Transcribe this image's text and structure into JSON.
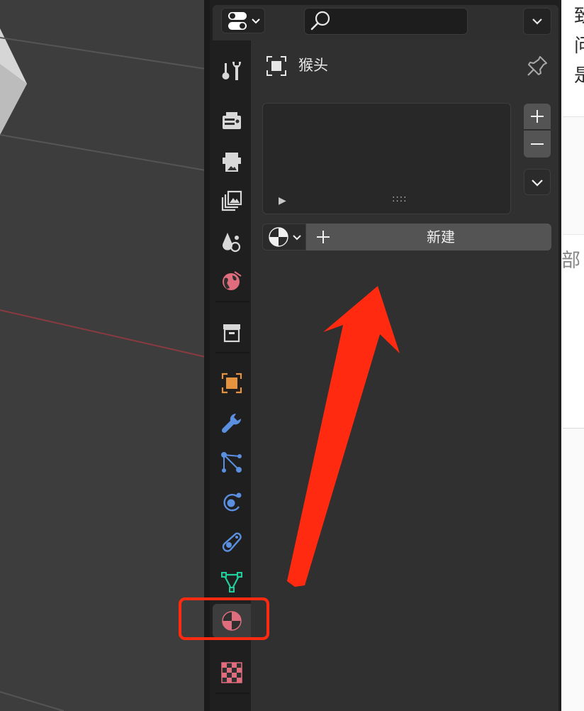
{
  "properties": {
    "object_name": "猴头",
    "search": {
      "placeholder": ""
    },
    "new_material_label": "新建"
  },
  "tabs": [
    "tool",
    "render",
    "output",
    "view-layer",
    "scene",
    "world",
    "collection",
    "object",
    "modifiers",
    "particles",
    "physics",
    "constraints",
    "data",
    "material",
    "texture"
  ],
  "active_tab": "material",
  "right_window_text": {
    "line1": "致",
    "line2": "问",
    "line3": "是",
    "lower": "部"
  },
  "colors": {
    "annotation": "#ff2a10",
    "active_tab_bg": "#3d3d3d",
    "material_icon": "#e06d7d",
    "object_icon": "#e5933f",
    "modifier_icon": "#5b8fe0",
    "data_icon": "#1fcf9b"
  }
}
